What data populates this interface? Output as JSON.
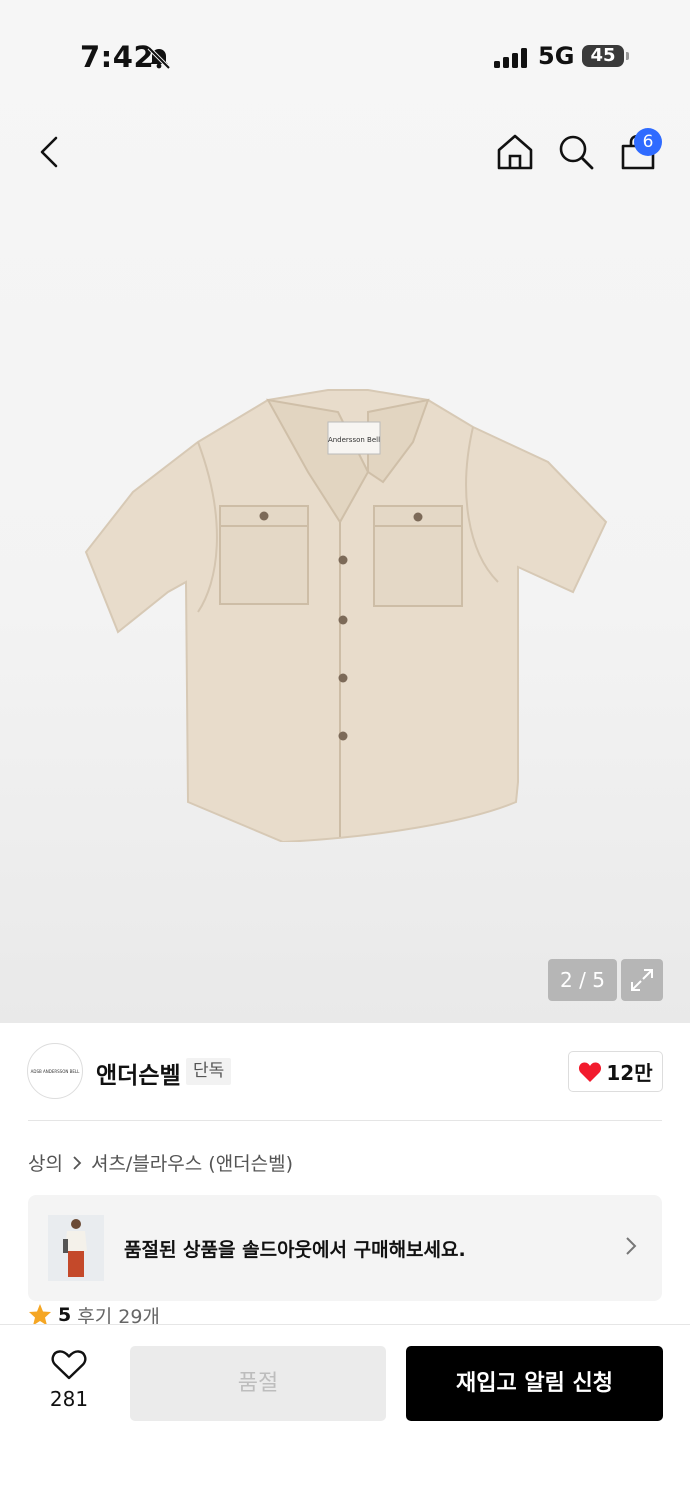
{
  "status_bar": {
    "time": "7:42",
    "network": "5G",
    "battery": "45",
    "icons": [
      "bell-slash-icon",
      "signal-icon"
    ]
  },
  "header": {
    "icons": [
      "back-icon",
      "home-icon",
      "search-icon",
      "bag-icon"
    ],
    "cart_count": "6"
  },
  "gallery": {
    "counter": "2 / 5",
    "shirt_label": "Andersson Bell",
    "expand_icon": "expand-icon"
  },
  "brand": {
    "logo_text": "ADSB ANDERSSON BELL",
    "name": "앤더슨벨",
    "tag": "단독",
    "like_count": "12만",
    "heart_color": "#f21b2d"
  },
  "breadcrumb": {
    "items": [
      "상의",
      "셔츠/블라우스 (앤더슨벨)"
    ]
  },
  "soldout_banner": {
    "text": "품절된 상품을 솔드아웃에서 구매해보세요."
  },
  "rating": {
    "score": "5",
    "reviews": "후기 29개",
    "star_color": "#f5a623"
  },
  "bottom_bar": {
    "wish_count": "281",
    "soldout_label": "품절",
    "restock_label": "재입고 알림 신청"
  }
}
